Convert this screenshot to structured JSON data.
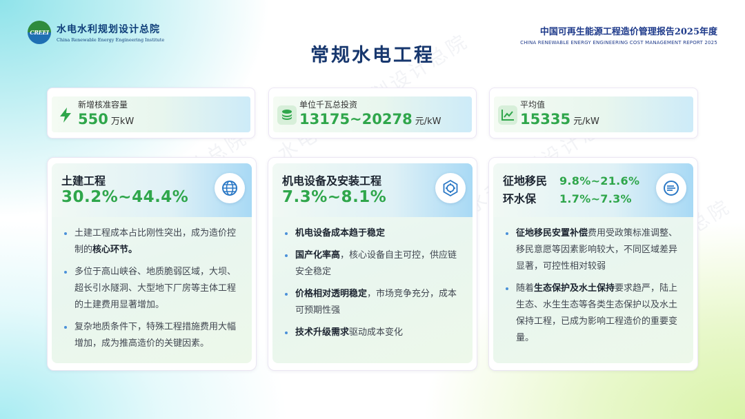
{
  "header": {
    "logo_badge": "CREEI",
    "logo_cn": "水电水利规划设计总院",
    "logo_en": "China Renewable Energy Engineering Institute",
    "report_cn": "中国可再生能源工程造价管理报告2025年度",
    "report_en": "CHINA RENEWABLE ENERGY ENGINEERING COST MANAGEMENT REPORT 2025"
  },
  "page_title": "常规水电工程",
  "watermark": "水电水利规划设计总院",
  "stats": [
    {
      "label": "新增核准容量",
      "value": "550",
      "unit": "万kW",
      "icon": "lightning-icon"
    },
    {
      "label": "单位千瓦总投资",
      "value": "13175~20278",
      "unit": "元/kW",
      "icon": "coins-icon"
    },
    {
      "label": "平均值",
      "value": "15335",
      "unit": "元/kW",
      "icon": "line-chart-icon"
    }
  ],
  "cards": {
    "civil": {
      "title": "土建工程",
      "pct": "30.2%~44.4%",
      "icon": "globe-icon",
      "b1": "土建工程成本占比刚性突出，成为造价控制的",
      "b1_bold": "核心环节。",
      "b2": "多位于高山峡谷、地质脆弱区域，大坝、超长引水隧洞、大型地下厂房等主体工程的土建费用显著增加。",
      "b3": "复杂地质条件下，特殊工程措施费用大幅增加，成为推高造价的关键因素。"
    },
    "mech": {
      "title": "机电设备及安装工程",
      "pct": "7.3%~8.1%",
      "icon": "hexagon-gear-icon",
      "b1_bold": "机电设备成本趋于稳定",
      "b2_bold": "国产化率高",
      "b2": "，核心设备自主可控，供应链安全稳定",
      "b3_bold": "价格相对透明稳定",
      "b3": "，市场竞争充分，成本可预期性强",
      "b4_bold": "技术升级需求",
      "b4": "驱动成本变化"
    },
    "land": {
      "title1": "征地移民",
      "pct1": "9.8%~21.6%",
      "title2": "环水保",
      "pct2": "1.7%~7.3%",
      "icon": "leaf-circle-icon",
      "b1_bold": "征地移民安置补偿",
      "b1": "费用受政策标准调整、移民意愿等因素影响较大，不同区域差异显著，可控性相对较弱",
      "b2_pre": "随着",
      "b2_bold": "生态保护及水土保持",
      "b2": "要求趋严，陆上生态、水生生态等各类生态保护以及水土保持工程，已成为影响工程造价的重要变量。"
    }
  },
  "colors": {
    "accent_green": "#2fa64b",
    "title_navy": "#17376e",
    "bullet_blue": "#4a90d9"
  }
}
